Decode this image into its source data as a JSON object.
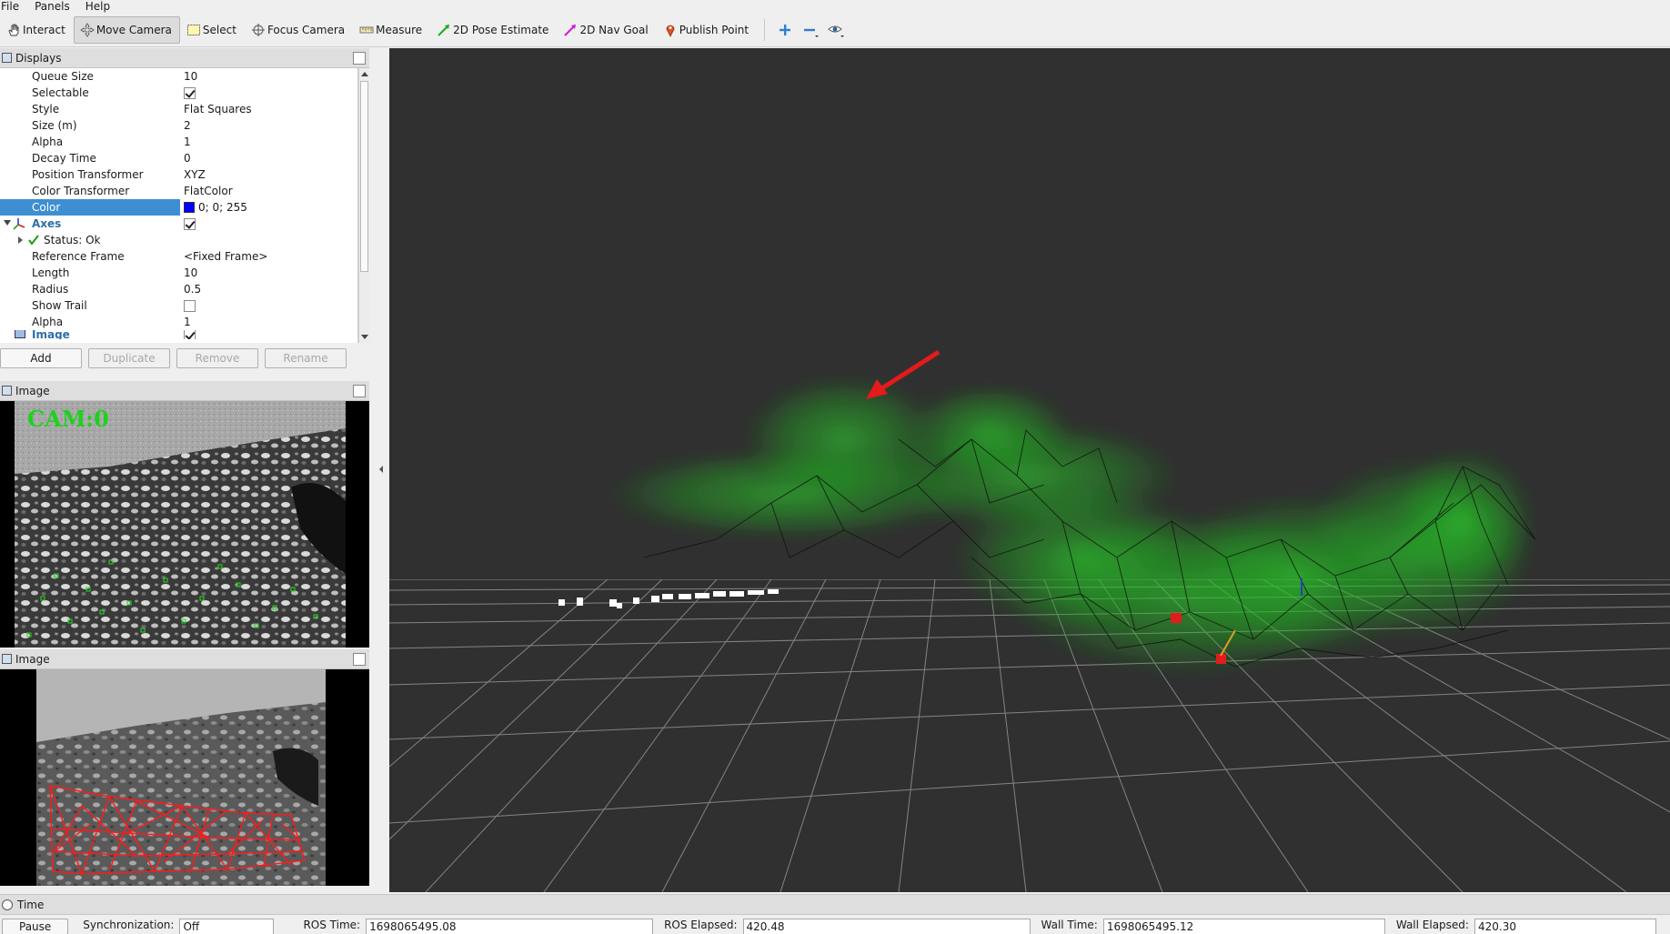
{
  "menubar": {
    "items": [
      "File",
      "Panels",
      "Help"
    ]
  },
  "toolbar": {
    "tools": [
      {
        "label": "Interact",
        "icon": "hand-icon"
      },
      {
        "label": "Move Camera",
        "icon": "move-camera-icon",
        "active": true
      },
      {
        "label": "Select",
        "icon": "select-box-icon"
      },
      {
        "label": "Focus Camera",
        "icon": "crosshair-icon"
      },
      {
        "label": "Measure",
        "icon": "ruler-icon"
      },
      {
        "label": "2D Pose Estimate",
        "icon": "green-arrow-icon"
      },
      {
        "label": "2D Nav Goal",
        "icon": "magenta-arrow-icon"
      },
      {
        "label": "Publish Point",
        "icon": "map-pin-icon"
      }
    ]
  },
  "displays": {
    "title": "Displays",
    "rows": [
      {
        "name": "Queue Size",
        "value": "10"
      },
      {
        "name": "Selectable",
        "value": "",
        "checkbox": true,
        "checked": true
      },
      {
        "name": "Style",
        "value": "Flat Squares"
      },
      {
        "name": "Size (m)",
        "value": "2"
      },
      {
        "name": "Alpha",
        "value": "1"
      },
      {
        "name": "Decay Time",
        "value": "0"
      },
      {
        "name": "Position Transformer",
        "value": "XYZ"
      },
      {
        "name": "Color Transformer",
        "value": "FlatColor"
      },
      {
        "name": "Color",
        "value": "0; 0; 255",
        "selected": true,
        "swatch": "#0000ff"
      },
      {
        "name": "Axes",
        "value": "",
        "group": true,
        "checkbox": true,
        "checked": true
      },
      {
        "name": "Status: Ok",
        "value": "",
        "status": true
      },
      {
        "name": "Reference Frame",
        "value": "<Fixed Frame>"
      },
      {
        "name": "Length",
        "value": "10"
      },
      {
        "name": "Radius",
        "value": "0.5"
      },
      {
        "name": "Show Trail",
        "value": "",
        "checkbox": true,
        "checked": false
      },
      {
        "name": "Alpha",
        "value": "1"
      },
      {
        "name": "Image",
        "value": "",
        "group": true,
        "checkbox": true,
        "checked": true
      }
    ],
    "buttons": {
      "add": "Add",
      "duplicate": "Duplicate",
      "remove": "Remove",
      "rename": "Rename"
    }
  },
  "image_panel_1": {
    "title": "Image",
    "overlay": "CAM:0"
  },
  "image_panel_2": {
    "title": "Image"
  },
  "time": {
    "title": "Time",
    "pause": "Pause",
    "sync_label": "Synchronization:",
    "sync_value": "Off",
    "ros_time_label": "ROS Time:",
    "ros_time": "1698065495.08",
    "ros_elapsed_label": "ROS Elapsed:",
    "ros_elapsed": "420.48",
    "wall_time_label": "Wall Time:",
    "wall_time": "1698065495.12",
    "wall_elapsed_label": "Wall Elapsed:",
    "wall_elapsed": "420.30"
  },
  "colors": {
    "selection": "#3d8fd1",
    "view_bg": "#303030",
    "cloud": "#1fd11f",
    "mesh": "#ff1a1a"
  }
}
